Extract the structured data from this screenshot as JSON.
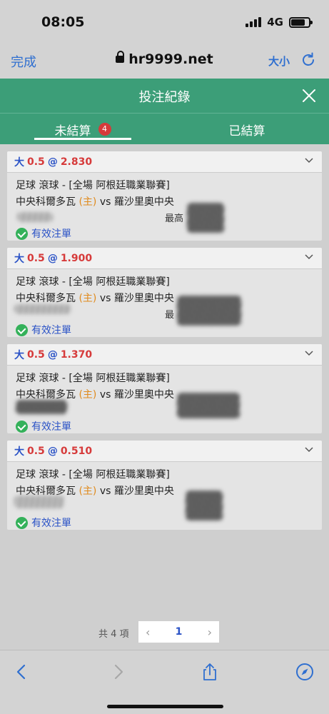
{
  "status": {
    "time": "08:05",
    "network": "4G"
  },
  "browser": {
    "done_label": "完成",
    "url": "hr9999.net",
    "text_size_label": "大小"
  },
  "header": {
    "title": "投注紀錄"
  },
  "tabs": {
    "unsettled": "未結算",
    "unsettled_count": "4",
    "settled": "已結算"
  },
  "colors": {
    "brand_green": "#3c9e78",
    "odds_red": "#d63a3a",
    "link_blue": "#2a52c6",
    "home_orange": "#e08a1c",
    "valid_green": "#34b15a"
  },
  "bets": [
    {
      "pick": "大",
      "line": "0.5",
      "at": "@",
      "odds": "2.830",
      "league": "足球 滾球 - [全場 阿根廷職業聯賽]",
      "home_team": "中央科爾多瓦",
      "home_tag": "(主)",
      "vs": "vs",
      "away_team": "羅沙里奧中央",
      "max_win_label": "最高",
      "status": "有效注單"
    },
    {
      "pick": "大",
      "line": "0.5",
      "at": "@",
      "odds": "1.900",
      "league": "足球 滾球 - [全場 阿根廷職業聯賽]",
      "home_team": "中央科爾多瓦",
      "home_tag": "(主)",
      "vs": "vs",
      "away_team": "羅沙里奧中央",
      "max_win_label": "最",
      "status": "有效注單"
    },
    {
      "pick": "大",
      "line": "0.5",
      "at": "@",
      "odds": "1.370",
      "league": "足球 滾球 - [全場 阿根廷職業聯賽]",
      "home_team": "中央科爾多瓦",
      "home_tag": "(主)",
      "vs": "vs",
      "away_team": "羅沙里奧中央",
      "max_win_label": "",
      "status": "有效注單"
    },
    {
      "pick": "大",
      "line": "0.5",
      "at": "@",
      "odds": "0.510",
      "league": "足球 滾球 - [全場 阿根廷職業聯賽]",
      "home_team": "中央科爾多瓦",
      "home_tag": "(主)",
      "vs": "vs",
      "away_team": "羅沙里奧中央",
      "max_win_label": "",
      "status": "有效注單"
    }
  ],
  "pagination": {
    "total_label": "共 4 項",
    "prev": "‹",
    "current": "1",
    "next": "›"
  }
}
